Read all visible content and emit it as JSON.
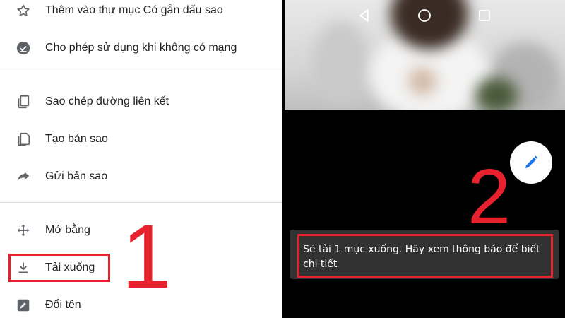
{
  "menu": {
    "items": [
      {
        "icon": "star-outline-icon",
        "label": "Thêm vào thư mục Có gắn dấu sao"
      },
      {
        "icon": "offline-check-icon",
        "label": "Cho phép sử dụng khi không có mạng"
      },
      {
        "icon": "copy-link-icon",
        "label": "Sao chép đường liên kết"
      },
      {
        "icon": "make-copy-icon",
        "label": "Tạo bản sao"
      },
      {
        "icon": "share-arrow-icon",
        "label": "Gửi bản sao"
      },
      {
        "icon": "open-with-icon",
        "label": "Mở bằng"
      },
      {
        "icon": "download-icon",
        "label": "Tải xuống"
      },
      {
        "icon": "rename-icon",
        "label": "Đổi tên"
      }
    ]
  },
  "annotations": {
    "step1": "1",
    "step2": "2",
    "color": "#e8212e"
  },
  "snackbar": {
    "text": "Sẽ tải 1 mục xuống. Hãy xem thông báo để biết chi tiết"
  },
  "fab": {
    "icon": "pencil-icon",
    "color": "#1a73e8"
  },
  "nav": {
    "back": "back-triangle-icon",
    "home": "home-circle-icon",
    "recent": "recent-square-icon"
  }
}
